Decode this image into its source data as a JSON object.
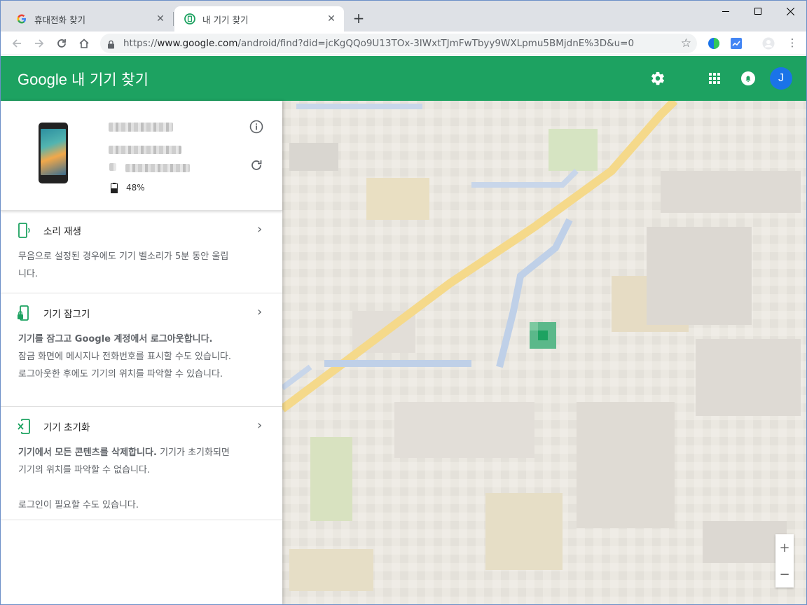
{
  "browser": {
    "tabs": [
      {
        "title": "휴대전화 찾기",
        "active": false
      },
      {
        "title": "내 기기 찾기",
        "active": true
      }
    ],
    "url": {
      "scheme": "https://",
      "host": "www.google.com",
      "path": "/android/find?did=jcKgQQo9U13TOx-3IWxtTJmFwTbyy9WXLpmu5BMjdnE%3D&u=0"
    }
  },
  "app": {
    "brand": "Google",
    "title": "내 기기 찾기",
    "accent_color": "#1da261",
    "avatar_initial": "J"
  },
  "device": {
    "battery": "48%"
  },
  "actions": [
    {
      "title": "소리 재생",
      "description": "무음으로 설정된 경우에도 기기 벨소리가 5분 동안 울립니다.",
      "icon": "phone-ring-icon"
    },
    {
      "title": "기기 잠그기",
      "description_bold": "기기를 잠그고 Google 계정에서 로그아웃합니다.",
      "description": "잠금 화면에 메시지나 전화번호를 표시할 수도 있습니다. 로그아웃한 후에도 기기의 위치를 파악할 수 있습니다.",
      "icon": "phone-lock-icon"
    },
    {
      "title": "기기 초기화",
      "description_bold": "기기에서 모든 콘텐츠를 삭제합니다.",
      "description": "기기가 초기화되면 기기의 위치를 파악할 수 없습니다.",
      "note": "로그인이 필요할 수도 있습니다.",
      "icon": "phone-erase-icon"
    }
  ],
  "map": {
    "zoom_in": "+",
    "zoom_out": "−"
  }
}
